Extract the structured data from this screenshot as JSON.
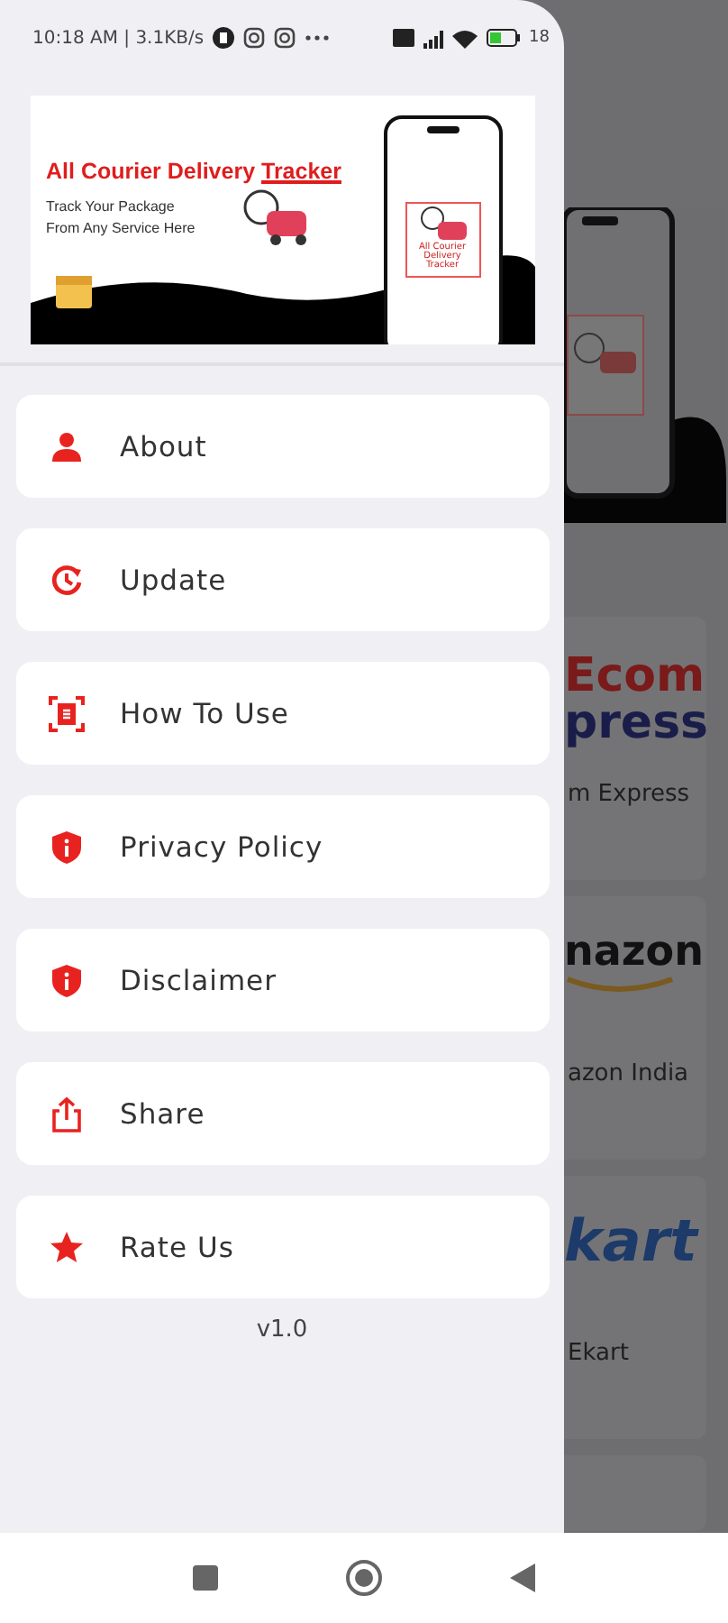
{
  "status_bar": {
    "time": "10:18 AM | 3.1KB/s",
    "battery": "18"
  },
  "drawer": {
    "banner": {
      "title": "All Courier Delivery **Tracker**",
      "subtitle": "Track Your Package\nFrom Any Service Here",
      "phone_caption": "All Courier Delivery Tracker"
    },
    "menu": [
      {
        "label": "About",
        "kind": "person"
      },
      {
        "label": "Update",
        "kind": "update"
      },
      {
        "label": "How To Use",
        "kind": "scan"
      },
      {
        "label": "Privacy Policy",
        "kind": "shield"
      },
      {
        "label": "Disclaimer",
        "kind": "shield"
      },
      {
        "label": "Share",
        "kind": "share"
      },
      {
        "label": "Rate Us",
        "kind": "star"
      }
    ],
    "version": "v1.0"
  },
  "background": {
    "couriers": [
      {
        "logo": [
          "Ecom",
          "press"
        ],
        "kind": "ecom",
        "name": "m Express"
      },
      {
        "logo": [
          "nazon"
        ],
        "kind": "amazon",
        "name": "azon India"
      },
      {
        "logo": [
          "kart"
        ],
        "kind": "ekart",
        "name": "Ekart"
      }
    ]
  }
}
